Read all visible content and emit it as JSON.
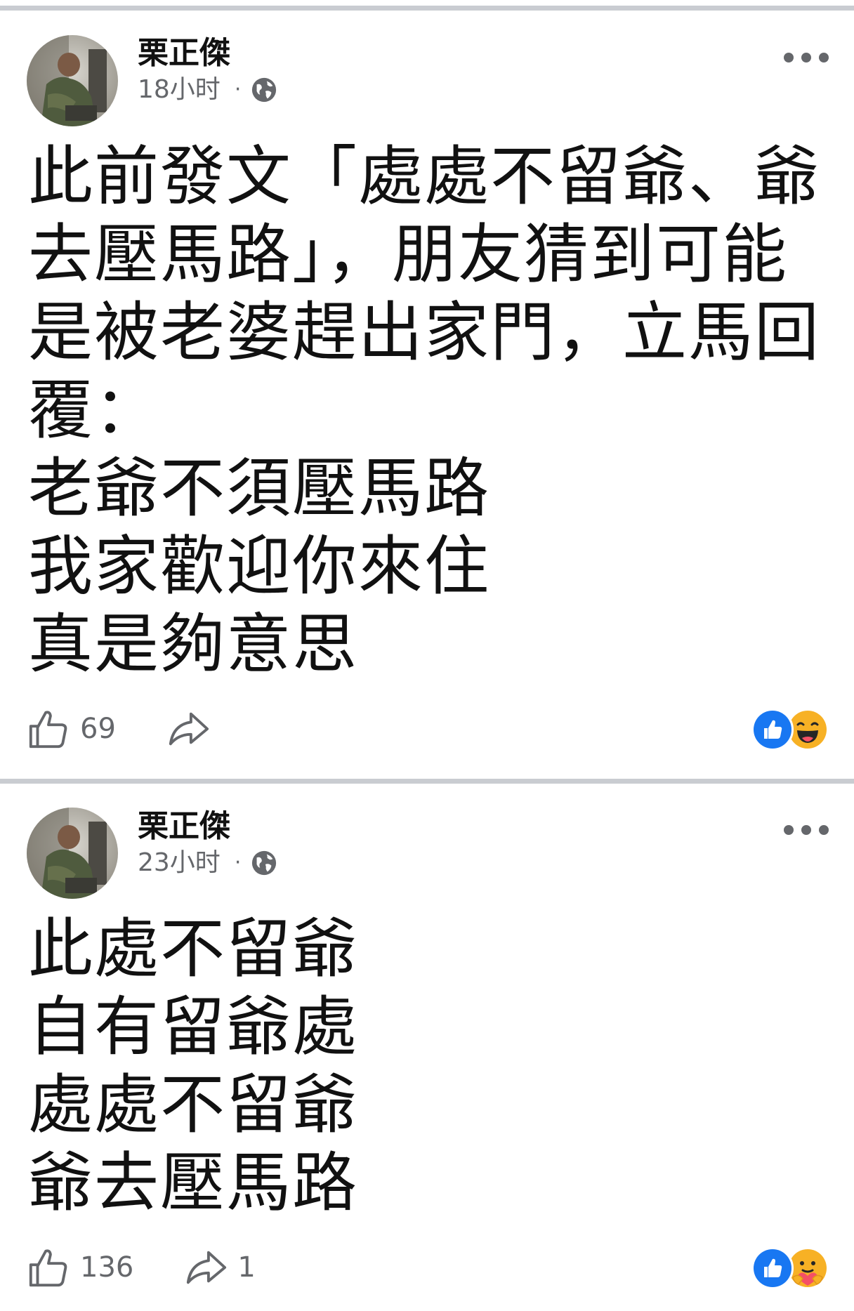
{
  "posts": [
    {
      "author": "栗正傑",
      "time": "18小时",
      "separator": "·",
      "privacy_icon": "globe-icon",
      "body": "此前發文「處處不留爺、爺\n去壓馬路」，朋友猜到可能\n是被老婆趕出家門，立馬回\n覆：\n老爺不須壓馬路\n我家歡迎你來住\n真是夠意思",
      "like_count": "69",
      "share_count": "",
      "reactions": [
        "like-reaction-icon",
        "haha-reaction-icon"
      ]
    },
    {
      "author": "栗正傑",
      "time": "23小时",
      "separator": "·",
      "privacy_icon": "globe-icon",
      "body": "此處不留爺\n自有留爺處\n處處不留爺\n爺去壓馬路",
      "like_count": "136",
      "share_count": "1",
      "reactions": [
        "like-reaction-icon",
        "care-reaction-icon"
      ]
    }
  ],
  "colors": {
    "divider": "#c9ccd1",
    "meta_text": "#65676b",
    "like_blue": "#1877f2",
    "haha_yellow": "#f7b125"
  }
}
